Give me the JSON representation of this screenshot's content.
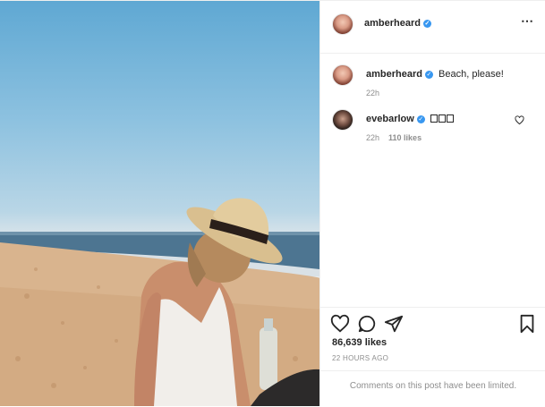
{
  "post": {
    "author": "amberheard",
    "verified_mark": "✓",
    "more_icon": "⋯"
  },
  "comments": [
    {
      "user": "amberheard",
      "text": "Beach, please!",
      "time": "22h",
      "likes": ""
    },
    {
      "user": "evebarlow",
      "text": "",
      "time": "22h",
      "likes": "110 likes"
    }
  ],
  "actions": {
    "like_icon": "heart-icon",
    "comment_icon": "comment-icon",
    "share_icon": "share-icon",
    "save_icon": "bookmark-icon"
  },
  "likes_count": "86,639 likes",
  "posted_ago": "22 HOURS AGO",
  "comments_disabled_notice": "Comments on this post have been limited.",
  "colors": {
    "verified": "#3897f0",
    "border": "#efefef",
    "secondary_text": "#8e8e8e"
  }
}
